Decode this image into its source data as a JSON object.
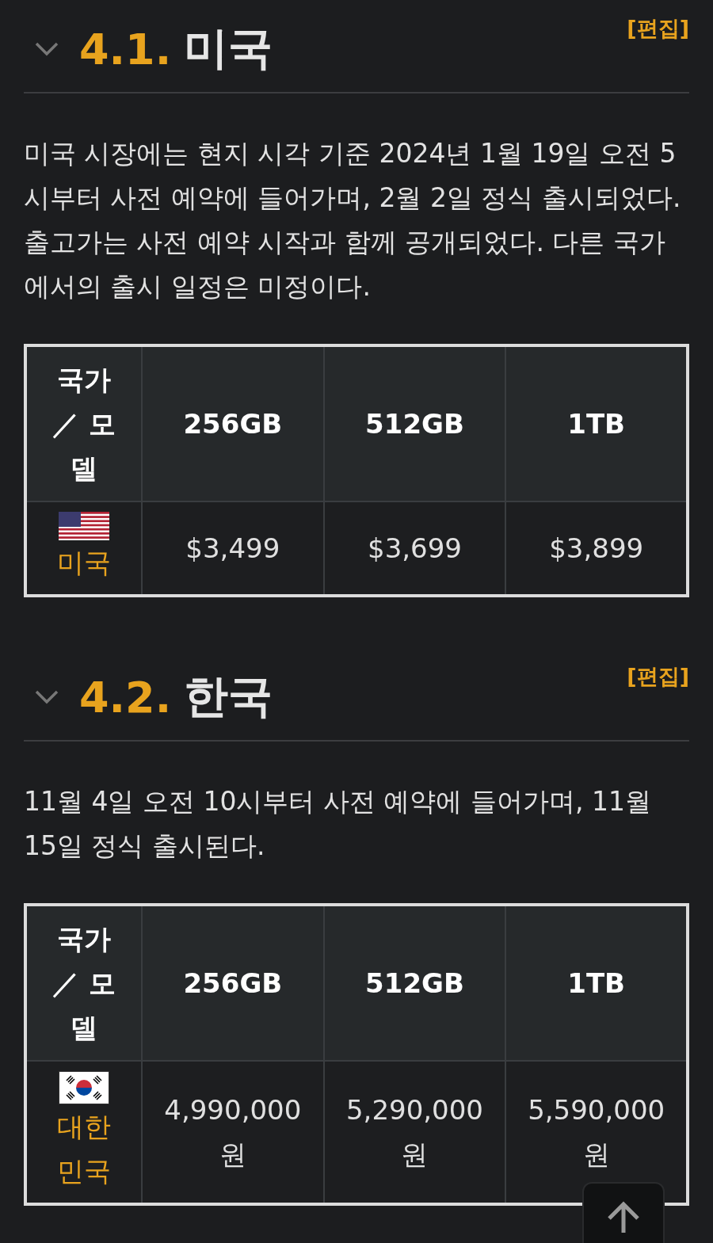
{
  "sections": [
    {
      "number": "4.1.",
      "title": "미국",
      "edit": "[편집]",
      "text": "미국 시장에는 현지 시각 기준 2024년 1월 19일 오전 5시부터 사전 예약에 들어가며, 2월 2일 정식 출시되었다. 출고가는 사전 예약 시작과 함께 공개되었다. 다른 국가에서의 출시 일정은 미정이다.",
      "table": {
        "corner": "국가 ／ 모델",
        "columns": [
          "256GB",
          "512GB",
          "1TB"
        ],
        "rows": [
          {
            "kind": "us",
            "country": "미국",
            "prices": [
              "$3,499",
              "$3,699",
              "$3,899"
            ]
          }
        ]
      }
    },
    {
      "number": "4.2.",
      "title": "한국",
      "edit": "[편집]",
      "text": "11월 4일 오전 10시부터 사전 예약에 들어가며, 11월 15일 정식 출시된다.",
      "table": {
        "corner": "국가 ／ 모델",
        "columns": [
          "256GB",
          "512GB",
          "1TB"
        ],
        "rows": [
          {
            "kind": "kr",
            "country": "대한민국",
            "prices": [
              "4,990,000 원",
              "5,290,000 원",
              "5,590,000 원"
            ]
          }
        ]
      }
    }
  ]
}
